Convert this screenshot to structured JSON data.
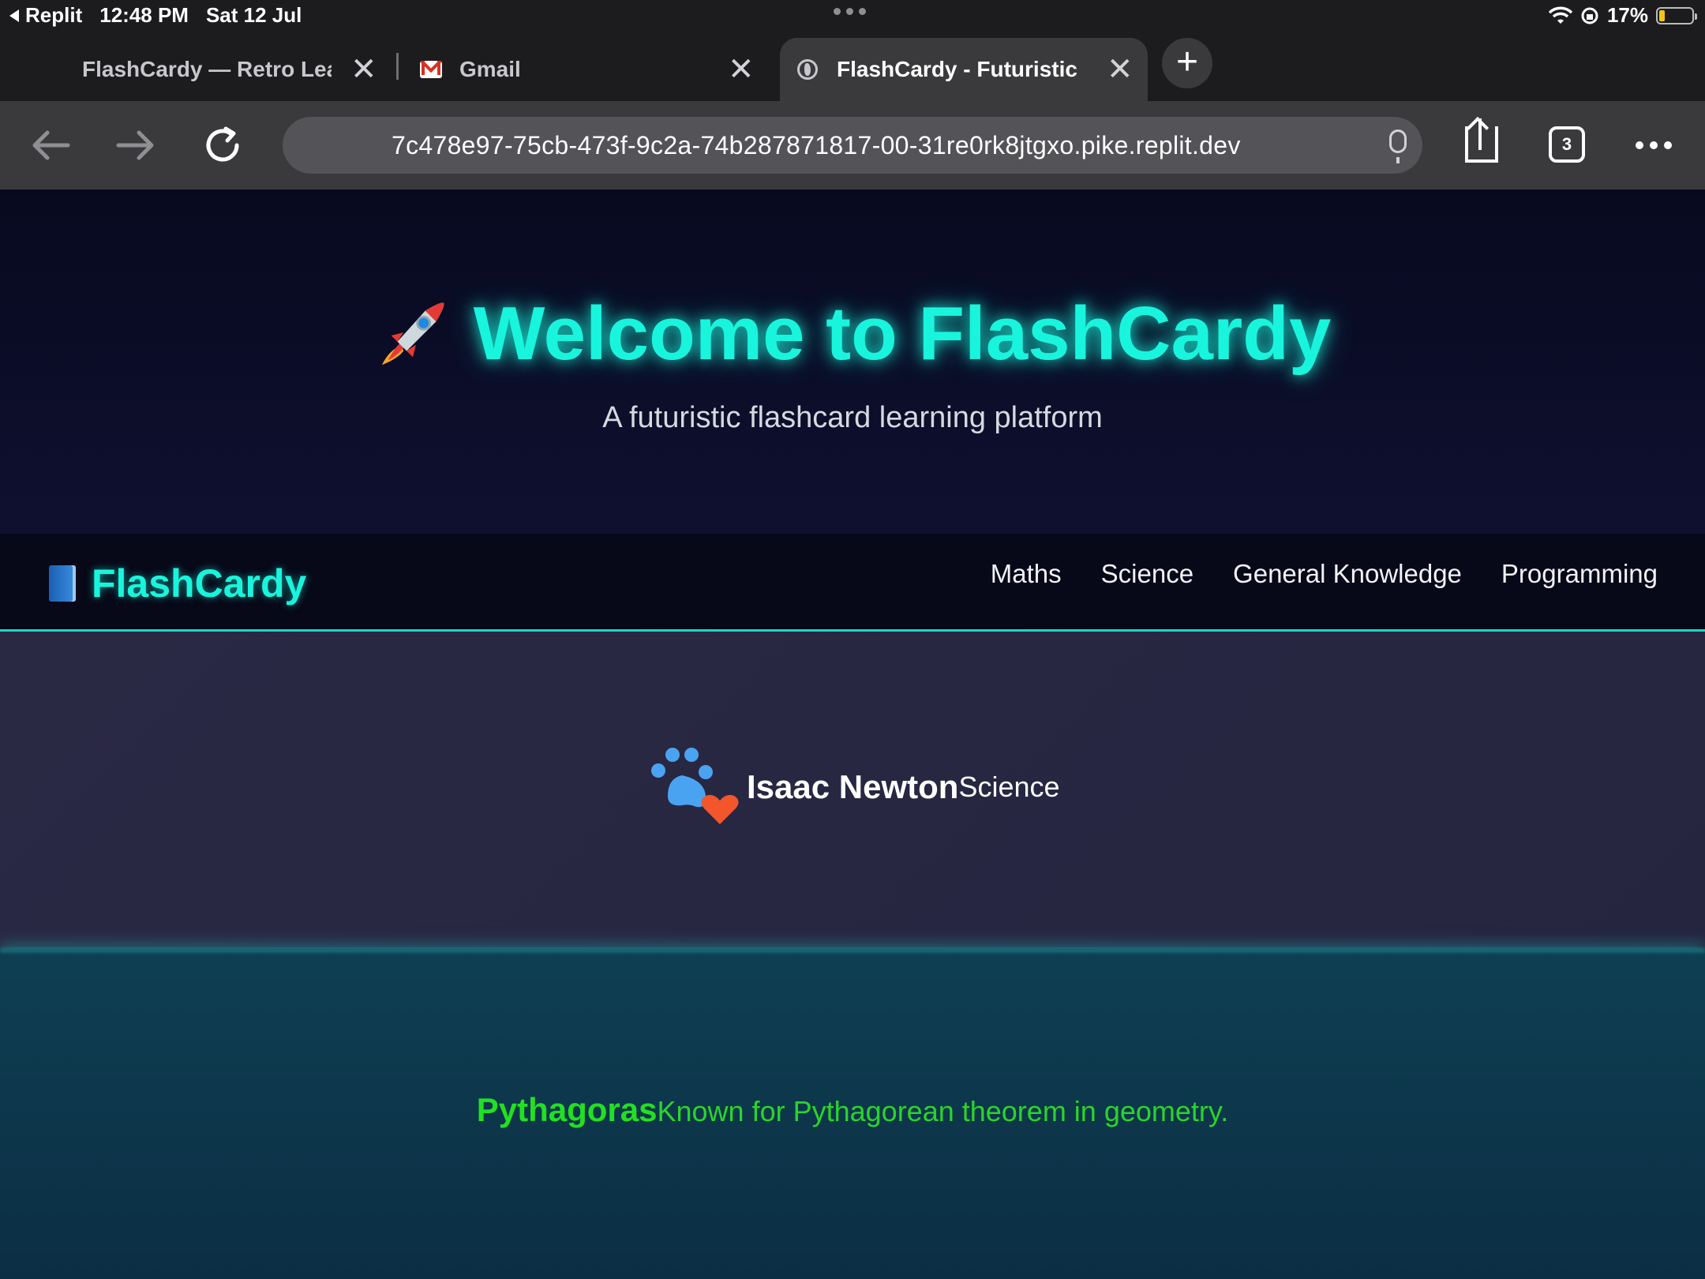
{
  "status_bar": {
    "back_app": "Replit",
    "time": "12:48 PM",
    "date": "Sat 12 Jul",
    "battery": "17%",
    "battery_level": 0.17
  },
  "tabs": [
    {
      "title": "FlashCardy — Retro Lea",
      "active": false
    },
    {
      "title": "Gmail",
      "active": false,
      "icon": "gmail-icon"
    },
    {
      "title": "FlashCardy - Futuristic",
      "active": true,
      "icon": "globe-icon"
    }
  ],
  "toolbar": {
    "url": "7c478e97-75cb-473f-9c2a-74b287871817-00-31re0rk8jtgxo.pike.replit.dev",
    "tab_count": "3"
  },
  "hero": {
    "emoji": "rocket-icon",
    "title": "Welcome to FlashCardy",
    "subtitle": "A futuristic flashcard learning platform"
  },
  "nav": {
    "brand": "FlashCardy",
    "links": [
      "Maths",
      "Science",
      "General Knowledge",
      "Programming"
    ]
  },
  "cards": [
    {
      "name": "Isaac Newton",
      "category": "Science",
      "icon": "paw-heart-icon"
    },
    {
      "name": "Pythagoras",
      "description": "Known for Pythagorean theorem in geometry."
    }
  ],
  "colors": {
    "accent": "#19f5dc",
    "card2_text": "#22e022"
  }
}
